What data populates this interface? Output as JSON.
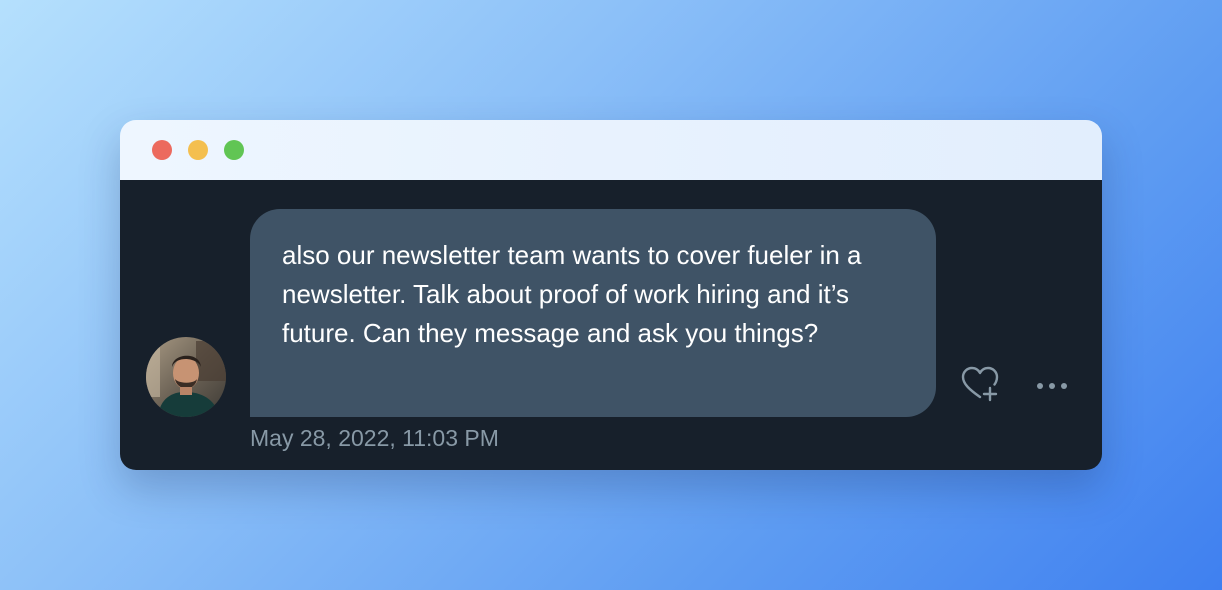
{
  "window": {
    "controls": [
      "close",
      "minimize",
      "maximize"
    ]
  },
  "message": {
    "text": "also our newsletter team wants to cover fueler in a newsletter. Talk about proof of work hiring and it’s future. Can they message and ask you things?",
    "timestamp": "May 28, 2022, 11:03 PM"
  },
  "icons": {
    "avatar": "user-avatar-photo",
    "like": "heart-plus-icon",
    "more": "more-horizontal-icon"
  },
  "colors": {
    "bubble": "#3f5366",
    "background": "#17202b",
    "timestamp": "#8899a6",
    "close": "#ec6a5e",
    "minimize": "#f4bf4f",
    "maximize": "#61c554"
  }
}
